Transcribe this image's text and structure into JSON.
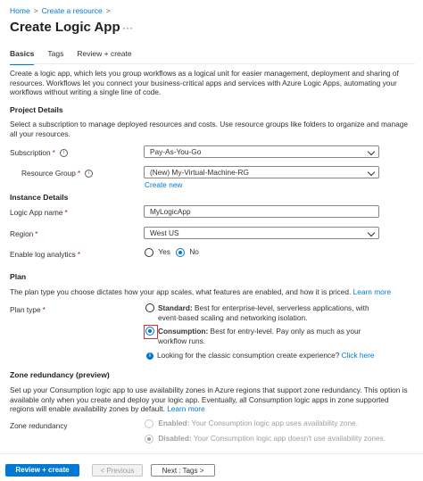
{
  "breadcrumb": {
    "home": "Home",
    "create": "Create a resource",
    "sep": ">"
  },
  "header": {
    "title": "Create Logic App",
    "more": "···"
  },
  "tabs": [
    {
      "label": "Basics",
      "active": true
    },
    {
      "label": "Tags",
      "active": false
    },
    {
      "label": "Review + create",
      "active": false
    }
  ],
  "intro": "Create a logic app, which lets you group workflows as a logical unit for easier management, deployment and sharing of resources. Workflows let you connect your business-critical apps and services with Azure Logic Apps, automating your workflows without writing a single line of code.",
  "project": {
    "heading": "Project Details",
    "desc": "Select a subscription to manage deployed resources and costs. Use resource groups like folders to organize and manage all your resources.",
    "subscription_label": "Subscription",
    "subscription_value": "Pay-As-You-Go",
    "rg_label": "Resource Group",
    "rg_value": "(New) My-Virtual-Machine-RG",
    "create_new": "Create new"
  },
  "instance": {
    "heading": "Instance Details",
    "name_label": "Logic App name",
    "name_value": "MyLogicApp",
    "region_label": "Region",
    "region_value": "West US",
    "log_label": "Enable log analytics",
    "yes": "Yes",
    "no": "No"
  },
  "plan": {
    "heading": "Plan",
    "desc": "The plan type you choose dictates how your app scales, what features are enabled, and how it is priced.",
    "learn_more": "Learn more",
    "type_label": "Plan type",
    "standard_title": "Standard:",
    "standard_desc": "Best for enterprise-level, serverless applications, with event-based scaling and networking isolation.",
    "consumption_title": "Consumption:",
    "consumption_desc": "Best for entry-level. Pay only as much as your workflow runs.",
    "classic_text": "Looking for the classic consumption create experience?",
    "classic_link": "Click here"
  },
  "zone": {
    "heading": "Zone redundancy (preview)",
    "desc": "Set up your Consumption logic app to use availability zones in Azure regions that support zone redundancy. This option is available only when you create and deploy your logic app. Eventually, all Consumption logic apps in zone supported regions will enable availability zones by default.",
    "learn_more": "Learn more",
    "label": "Zone redundancy",
    "enabled_title": "Enabled:",
    "enabled_desc": "Your Consumption logic app uses availability zone.",
    "disabled_title": "Disabled:",
    "disabled_desc": "Your Consumption logic app doesn't use availability zones."
  },
  "footer": {
    "review": "Review + create",
    "previous": "< Previous",
    "next": "Next : Tags >"
  },
  "colors": {
    "accent": "#0078d4",
    "highlight": "#d13438",
    "required": "#a4262c"
  }
}
